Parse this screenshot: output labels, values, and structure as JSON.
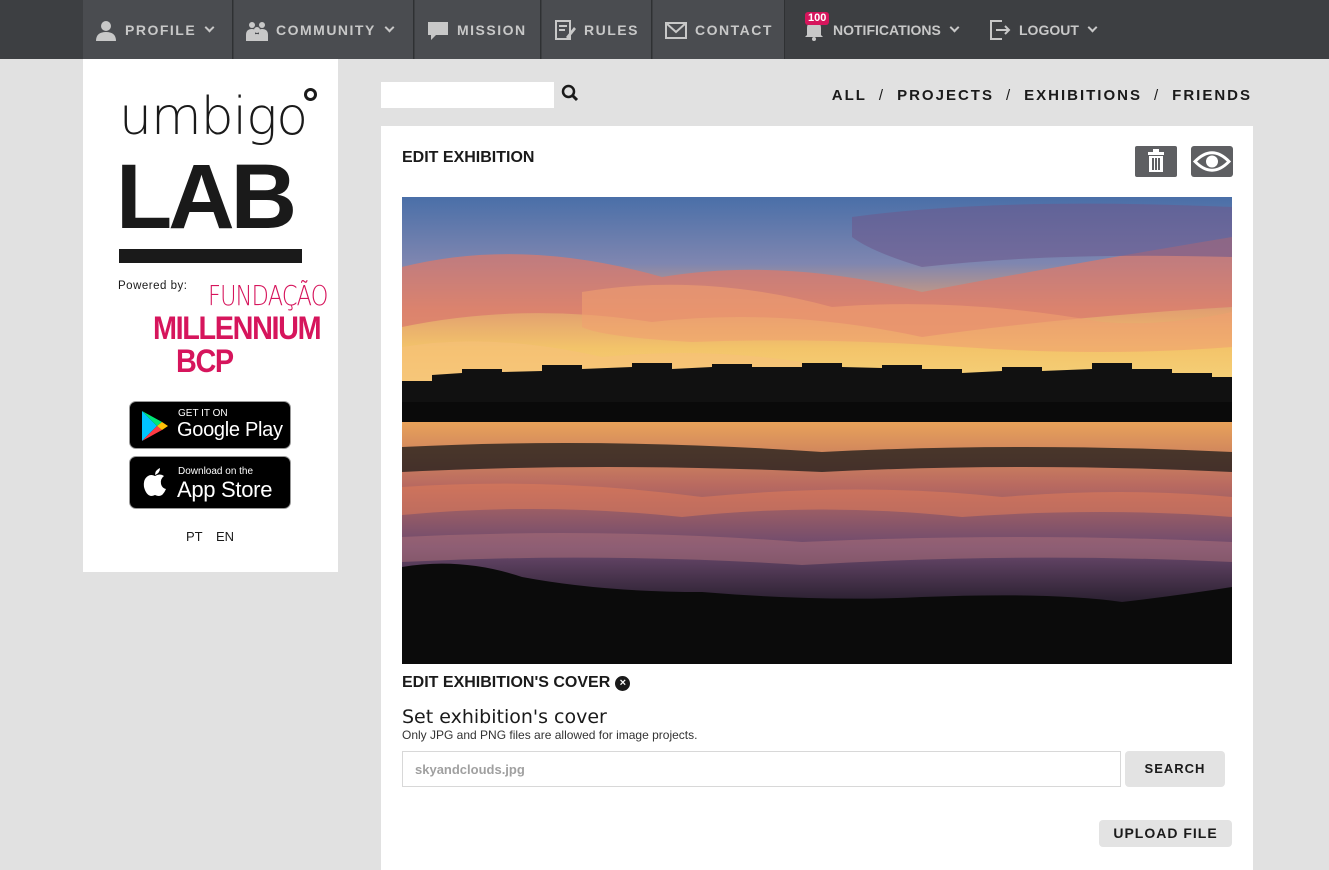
{
  "nav": {
    "profile": "PROFILE",
    "community": "COMMUNITY",
    "mission": "MISSION",
    "rules": "RULES",
    "contact": "CONTACT",
    "notifications": "NOTIFICATIONS",
    "notifications_count": "100",
    "logout": "LOGOUT"
  },
  "sidebar": {
    "logo_top": "umbigo",
    "logo_bottom": "LAB",
    "powered_by": "Powered by:",
    "sponsor_line1": "FUNDAÇÃO",
    "sponsor_line2": "MILLENNIUM",
    "sponsor_line3": "BCP",
    "google_play_small": "GET IT ON",
    "google_play_big": "Google Play",
    "app_store_small": "Download on the",
    "app_store_big": "App Store",
    "lang_pt": "PT",
    "lang_en": "EN"
  },
  "search": {
    "placeholder": ""
  },
  "filters": {
    "all": "ALL",
    "projects": "PROJECTS",
    "exhibitions": "EXHIBITIONS",
    "friends": "FRIENDS",
    "separator": "/"
  },
  "panel": {
    "title": "EDIT EXHIBITION",
    "cover_title": "EDIT EXHIBITION'S COVER",
    "set_cover": "Set exhibition's cover",
    "hint": "Only JPG and PNG files are allowed for image projects.",
    "file_value": "skyandclouds.jpg",
    "search_label": "SEARCH",
    "upload_label": "UPLOAD FILE"
  },
  "colors": {
    "accent": "#d6155c",
    "nav_bg": "#3d3f42"
  }
}
